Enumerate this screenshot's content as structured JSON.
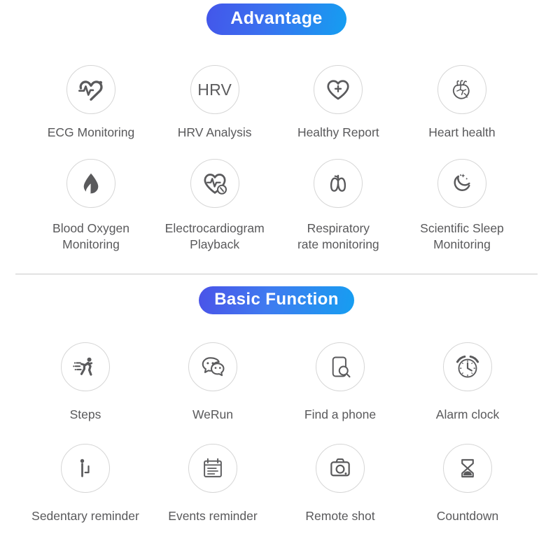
{
  "page": {
    "background": "#ffffff",
    "text_color": "#59595b",
    "icon_color": "#5a5a5c",
    "circle_border": "#d6d6d6",
    "divider_color": "#c9c9c9"
  },
  "sections": [
    {
      "id": "advantage",
      "badge_label": "Advantage",
      "badge_gradient_from": "#4356ea",
      "badge_gradient_to": "#159ef1",
      "rows": [
        [
          {
            "label": "ECG Monitoring",
            "icon": "heart-pulse-icon"
          },
          {
            "label": "HRV Analysis",
            "icon": "hrv-text-icon",
            "icon_text": "HRV"
          },
          {
            "label": "Healthy Report",
            "icon": "heart-plus-icon"
          },
          {
            "label": "Heart health",
            "icon": "anatomical-heart-icon"
          }
        ],
        [
          {
            "label": "Blood Oxygen\nMonitoring",
            "icon": "blood-drop-icon"
          },
          {
            "label": "Electrocardiogram\nPlayback",
            "icon": "heart-ecg-playback-icon"
          },
          {
            "label": "Respiratory\nrate monitoring",
            "icon": "lungs-icon"
          },
          {
            "label": "Scientific Sleep\nMonitoring",
            "icon": "moon-stars-icon"
          }
        ]
      ]
    },
    {
      "id": "basic-function",
      "badge_label": "Basic Function",
      "badge_gradient_from": "#4a53e8",
      "badge_gradient_to": "#169ef1",
      "rows": [
        [
          {
            "label": "Steps",
            "icon": "running-person-icon"
          },
          {
            "label": "WeRun",
            "icon": "chat-bubbles-icon"
          },
          {
            "label": "Find a phone",
            "icon": "phone-search-icon"
          },
          {
            "label": "Alarm clock",
            "icon": "alarm-clock-icon"
          }
        ],
        [
          {
            "label": "Sedentary reminder",
            "icon": "standing-person-chair-icon"
          },
          {
            "label": "Events reminder",
            "icon": "notepad-icon"
          },
          {
            "label": "Remote shot",
            "icon": "camera-icon"
          },
          {
            "label": "Countdown",
            "icon": "hourglass-icon"
          }
        ]
      ]
    }
  ]
}
